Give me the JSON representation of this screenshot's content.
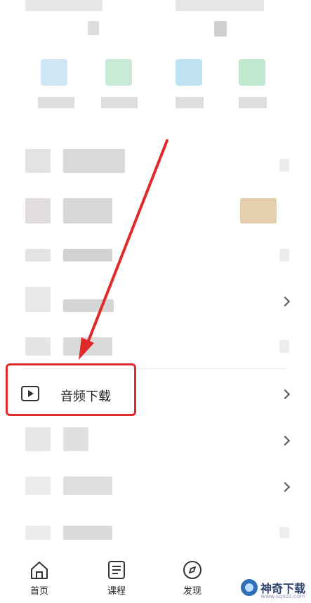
{
  "highlighted_item": {
    "label": "音频下载",
    "icon": "play-square-icon"
  },
  "bottom_nav": {
    "items": [
      {
        "label": "首页",
        "icon": "home-icon"
      },
      {
        "label": "课程",
        "icon": "course-list-icon"
      },
      {
        "label": "发现",
        "icon": "compass-icon"
      }
    ]
  },
  "watermark": {
    "text": "神奇下载",
    "url": "www.sqxzz.com"
  },
  "colors": {
    "highlight_border": "#e02a2a",
    "arrow": "#e02a2a"
  }
}
